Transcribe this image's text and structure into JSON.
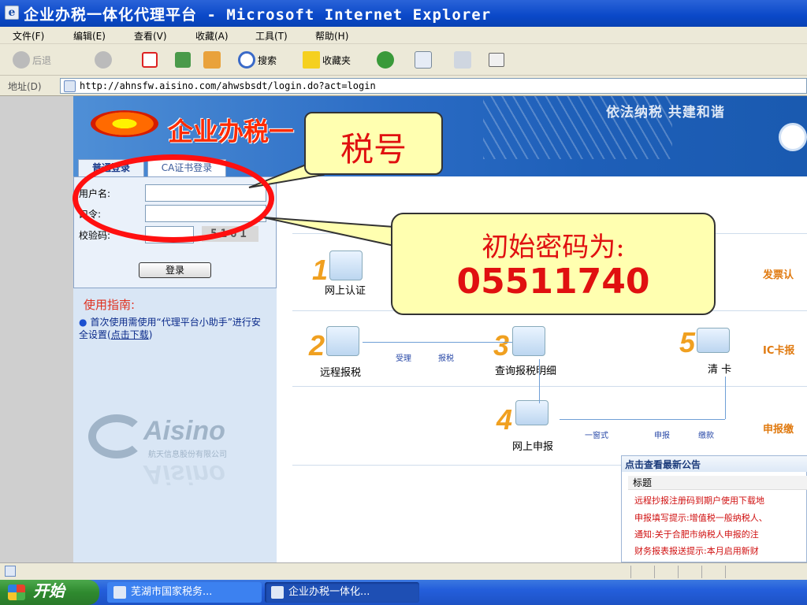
{
  "window": {
    "title": "企业办税一体化代理平台 - Microsoft Internet Explorer"
  },
  "menu": [
    "文件(F)",
    "编辑(E)",
    "查看(V)",
    "收藏(A)",
    "工具(T)",
    "帮助(H)"
  ],
  "toolbar": {
    "back": "后退",
    "search": "搜索",
    "favorites": "收藏夹"
  },
  "address": {
    "label": "地址(D)",
    "url": "http://ahnsfw.aisino.com/ahwsbsdt/login.do?act=login"
  },
  "banner": {
    "logo_text": "企业办税一",
    "slogan": "依法纳税 共建和谐"
  },
  "login": {
    "tab_normal": "普通登录",
    "tab_ca": "CA证书登录",
    "username_label": "用户名:",
    "password_label": "口令:",
    "captcha_label": "校验码:",
    "captcha_value": "5161",
    "submit": "登录"
  },
  "guide": {
    "title": "使用指南:",
    "text": "首次使用需使用“代理平台小助手”进行安全设置(",
    "link": "点击下载",
    "close": ")"
  },
  "company": {
    "logo": "Aisino",
    "name": "航天信息股份有限公司"
  },
  "flow": {
    "s1": {
      "num": "1",
      "label": "网上认证"
    },
    "s2": {
      "num": "2",
      "label": "远程报税"
    },
    "s3": {
      "num": "3",
      "label": "查询报税明细"
    },
    "s4": {
      "num": "4",
      "label": "网上申报"
    },
    "s5": {
      "num": "5",
      "label": "清 卡"
    },
    "small_accept": "受理",
    "small_report": "报税",
    "small_onestop": "一窗式",
    "small_declare": "申报",
    "small_pay": "缴款",
    "side_invoice": "发票认",
    "side_ic": "IC卡报",
    "side_declare": "申报缴"
  },
  "notice": {
    "header": "点击查看最新公告",
    "col": "标题",
    "rows": [
      "远程抄报注册码到期户使用下载地",
      "申报填写提示:增值税一般纳税人、",
      "通知:关于合肥市纳税人申报的注",
      "财务报表报送提示:本月启用新财"
    ]
  },
  "callouts": {
    "tax_id": "税号",
    "pwd_line1": "初始密码为:",
    "pwd_line2": "05511740"
  },
  "taskbar": {
    "start": "开始",
    "task1": "芜湖市国家税务...",
    "task2": "企业办税一体化..."
  }
}
